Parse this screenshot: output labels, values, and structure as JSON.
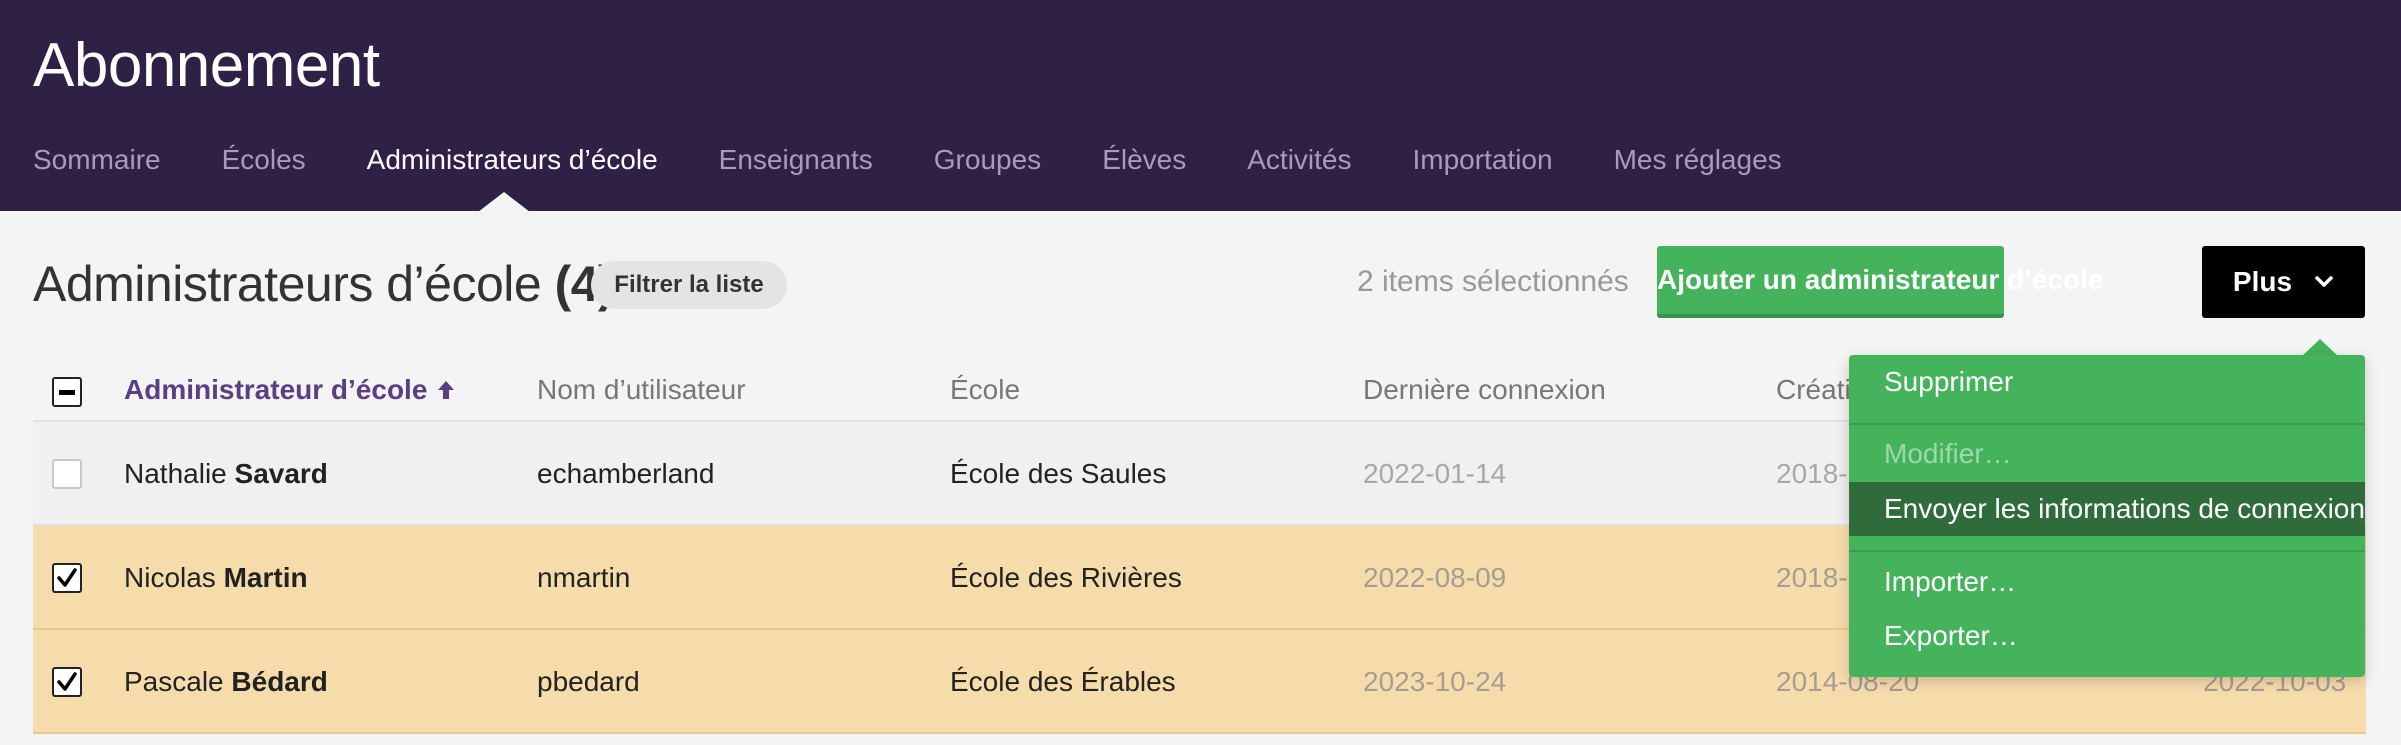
{
  "header": {
    "title": "Abonnement",
    "nav": [
      {
        "label": "Sommaire",
        "active": false
      },
      {
        "label": "Écoles",
        "active": false
      },
      {
        "label": "Administrateurs d’école",
        "active": true
      },
      {
        "label": "Enseignants",
        "active": false
      },
      {
        "label": "Groupes",
        "active": false
      },
      {
        "label": "Élèves",
        "active": false
      },
      {
        "label": "Activités",
        "active": false
      },
      {
        "label": "Importation",
        "active": false
      },
      {
        "label": "Mes réglages",
        "active": false
      }
    ]
  },
  "toolbar": {
    "title": "Administrateurs d’école",
    "count": "(4)",
    "filter_label": "Filtrer la liste",
    "selected_text": "2 items sélectionnés",
    "add_label": "Ajouter un administrateur d’école",
    "more_label": "Plus"
  },
  "table": {
    "columns": [
      "Administrateur d’école",
      "Nom d’utilisateur",
      "École",
      "Dernière connexion",
      "Créatio"
    ],
    "rows": [
      {
        "first": "Nathalie",
        "last": "Savard",
        "username": "echamberland",
        "school": "École des Saules",
        "last_login": "2022-01-14",
        "created": "2018-",
        "modified": "",
        "selected": false
      },
      {
        "first": "Nicolas",
        "last": "Martin",
        "username": "nmartin",
        "school": "École des Rivières",
        "last_login": "2022-08-09",
        "created": "2018-",
        "modified": "",
        "selected": true
      },
      {
        "first": "Pascale",
        "last": "Bédard",
        "username": "pbedard",
        "school": "École des Érables",
        "last_login": "2023-10-24",
        "created": "2014-08-20",
        "modified": "2022-10-03",
        "selected": true
      }
    ]
  },
  "dropdown": {
    "items": [
      {
        "label": "Supprimer",
        "state": "normal"
      },
      {
        "label": "Modifier…",
        "state": "disabled"
      },
      {
        "label": "Envoyer les informations de connexion",
        "state": "hover"
      },
      {
        "label": "Importer…",
        "state": "normal"
      },
      {
        "label": "Exporter…",
        "state": "normal"
      }
    ]
  },
  "colors": {
    "header_bg": "#2f2046",
    "accent_green": "#45b35c",
    "selected_row": "#f7dcab",
    "sort_purple": "#5a3f83"
  }
}
